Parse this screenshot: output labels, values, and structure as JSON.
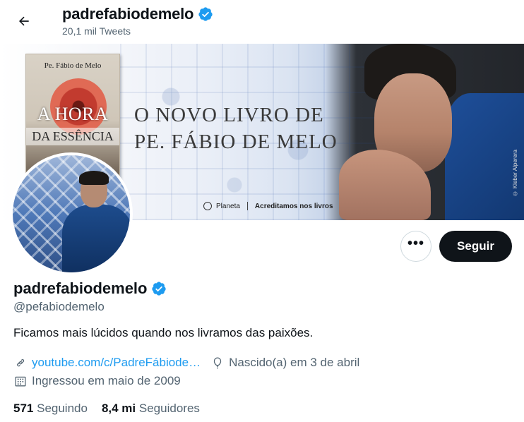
{
  "header": {
    "title": "padrefabiodemelo",
    "tweets_count": "20,1 mil Tweets",
    "back_icon": "arrow-left-icon"
  },
  "banner": {
    "book_author": "Pe. Fábio de Melo",
    "book_title": "A HORA",
    "book_subtitle": "DA ESSÊNCIA",
    "headline_line1": "O NOVO LIVRO DE",
    "headline_line2": "PE. FÁBIO DE MELO",
    "publisher": "Planeta",
    "tagline": "Acreditamos nos livros",
    "photo_credit": "© Kleber Alperera"
  },
  "actions": {
    "more_label": "•••",
    "follow_label": "Seguir"
  },
  "profile": {
    "name": "padrefabiodemelo",
    "handle": "@pefabiodemelo",
    "bio": "Ficamos mais lúcidos quando nos livramos das paixões.",
    "website": "youtube.com/c/PadreFábiode…",
    "birthday": "Nascido(a) em 3 de abril",
    "joined": "Ingressou em maio de 2009",
    "following_count": "571",
    "following_label": "Seguindo",
    "followers_count": "8,4 mi",
    "followers_label": "Seguidores"
  },
  "colors": {
    "accent": "#1d9bf0",
    "text_primary": "#0f1419",
    "text_secondary": "#536471",
    "follow_button_bg": "#0f1419"
  }
}
